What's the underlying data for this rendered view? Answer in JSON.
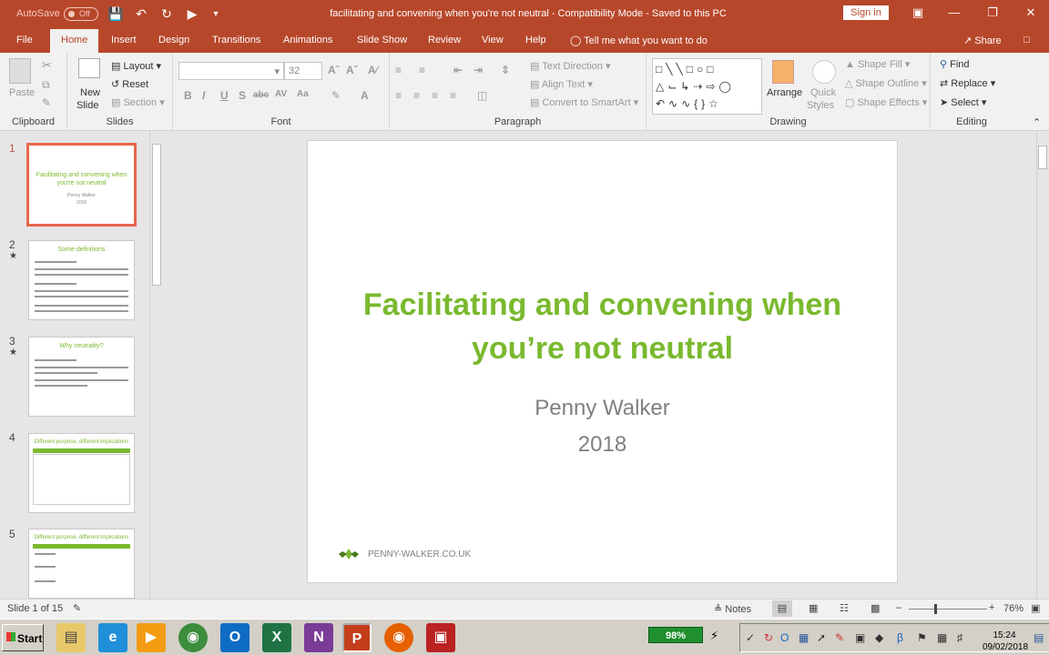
{
  "titlebar": {
    "autosave": "AutoSave",
    "autosave_state": "Off",
    "title": "facilitating and convening when you're not neutral  -  Compatibility Mode  -  Saved to this PC",
    "signin": "Sign in"
  },
  "tabs": [
    "File",
    "Home",
    "Insert",
    "Design",
    "Transitions",
    "Animations",
    "Slide Show",
    "Review",
    "View",
    "Help"
  ],
  "tellme": "Tell me what you want to do",
  "share": "Share",
  "ribbon": {
    "clipboard": {
      "paste": "Paste",
      "label": "Clipboard"
    },
    "slides": {
      "new_slide": "New",
      "new_slide2": "Slide",
      "layout": "Layout",
      "reset": "Reset",
      "section": "Section",
      "label": "Slides"
    },
    "font": {
      "size": "32",
      "label": "Font"
    },
    "paragraph": {
      "text_direction": "Text Direction",
      "align_text": "Align Text",
      "smartart": "Convert to SmartArt",
      "label": "Paragraph"
    },
    "drawing": {
      "arrange": "Arrange",
      "quick": "Quick",
      "styles": "Styles",
      "shape_fill": "Shape Fill",
      "shape_outline": "Shape Outline",
      "shape_effects": "Shape Effects",
      "label": "Drawing"
    },
    "editing": {
      "find": "Find",
      "replace": "Replace",
      "select": "Select",
      "label": "Editing"
    }
  },
  "thumbnails": [
    {
      "num": "1",
      "title": "Facilitating and convening when you're not neutral",
      "sub": "Penny Walker",
      "year": "2018"
    },
    {
      "num": "2",
      "title": "Some definitions"
    },
    {
      "num": "3",
      "title": "Why neutrality?"
    },
    {
      "num": "4",
      "title": "Different purpose, different implications"
    },
    {
      "num": "5",
      "title": "Different purpose, different implications"
    }
  ],
  "slide": {
    "title": "Facilitating and convening when you’re not neutral",
    "author": "Penny Walker",
    "year": "2018",
    "footer": "PENNY-WALKER.CO.UK"
  },
  "status": {
    "slide_of": "Slide 1 of 15",
    "notes": "Notes",
    "zoom": "76%"
  },
  "taskbar": {
    "start": "Start",
    "battery": "98%",
    "time": "15:24",
    "date": "09/02/2018"
  },
  "colors": {
    "accent": "#b7472a",
    "title_green": "#7ab92f",
    "selection": "#e7664c"
  }
}
